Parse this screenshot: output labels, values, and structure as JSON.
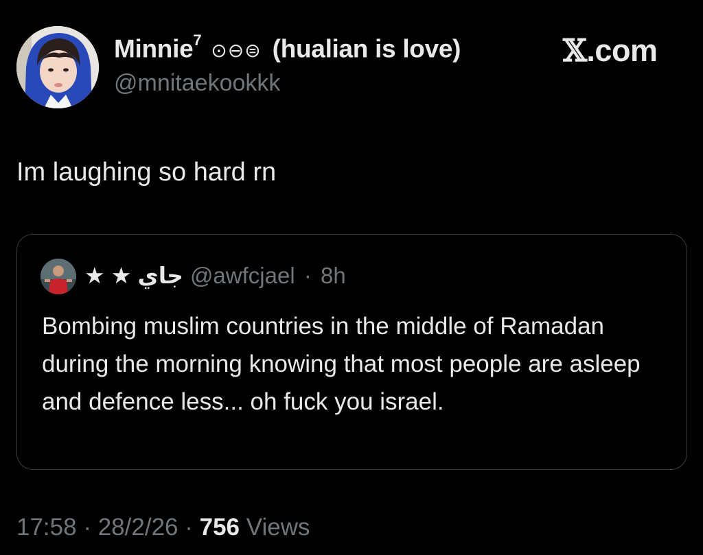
{
  "author": {
    "display_name": "Minnie",
    "superscript": "7",
    "name_symbols": "⊙⊖⊜",
    "name_suffix": "(hualian is love)",
    "handle": "@mnitaekookkk"
  },
  "brand": {
    "label": ".com"
  },
  "tweet": {
    "text": "Im laughing so hard rn"
  },
  "quoted_tweet": {
    "display_name": "★ ★ جاي",
    "handle": "@awfcjael",
    "separator": "·",
    "time_ago": "8h",
    "text": "Bombing muslim countries in the middle of Ramadan during the morning knowing that most people are asleep and defence less... oh fuck you israel."
  },
  "footer": {
    "time": "17:58",
    "date": "28/2/26",
    "sep": "·",
    "views_count": "756",
    "views_label": "Views"
  }
}
